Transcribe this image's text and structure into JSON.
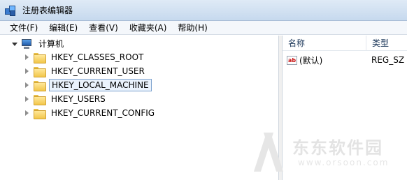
{
  "window": {
    "title": "注册表编辑器"
  },
  "menu": [
    {
      "label": "文件(F)"
    },
    {
      "label": "编辑(E)"
    },
    {
      "label": "查看(V)"
    },
    {
      "label": "收藏夹(A)"
    },
    {
      "label": "帮助(H)"
    }
  ],
  "tree": {
    "root": {
      "label": "计算机",
      "icon": "computer-icon",
      "expanded": true
    },
    "items": [
      {
        "label": "HKEY_CLASSES_ROOT",
        "icon": "folder-icon",
        "selected": false
      },
      {
        "label": "HKEY_CURRENT_USER",
        "icon": "folder-icon",
        "selected": false
      },
      {
        "label": "HKEY_LOCAL_MACHINE",
        "icon": "folder-icon",
        "selected": true
      },
      {
        "label": "HKEY_USERS",
        "icon": "folder-icon",
        "selected": false
      },
      {
        "label": "HKEY_CURRENT_CONFIG",
        "icon": "folder-icon",
        "selected": false
      }
    ]
  },
  "values": {
    "columns": [
      "名称",
      "类型"
    ],
    "rows": [
      {
        "name": "(默认)",
        "type": "REG_SZ",
        "icon": "ab"
      }
    ]
  },
  "watermark": {
    "text": "东东软件园",
    "url": "www.orsoon.com"
  }
}
